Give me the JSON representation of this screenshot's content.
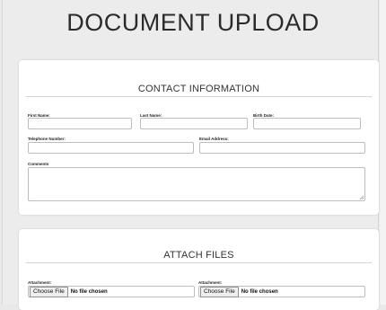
{
  "page": {
    "title": "DOCUMENT UPLOAD"
  },
  "contact": {
    "heading": "CONTACT INFORMATION",
    "first_name_label": "First Name:",
    "last_name_label": "Last Name:",
    "birth_date_label": "Birth Date:",
    "telephone_label": "Telephone Number:",
    "email_label": "Email Address:",
    "comments_label": "Comments"
  },
  "attach": {
    "heading": "ATTACH FILES",
    "files": [
      {
        "label": "Attachment:",
        "button": "Choose File",
        "status": "No file chosen"
      },
      {
        "label": "Attachment:",
        "button": "Choose File",
        "status": "No file chosen"
      }
    ]
  },
  "icons": {
    "resize": "resize-handle-icon"
  },
  "colors": {
    "background": "#ececec",
    "card": "#ffffff",
    "border": "#bdbdbd"
  }
}
